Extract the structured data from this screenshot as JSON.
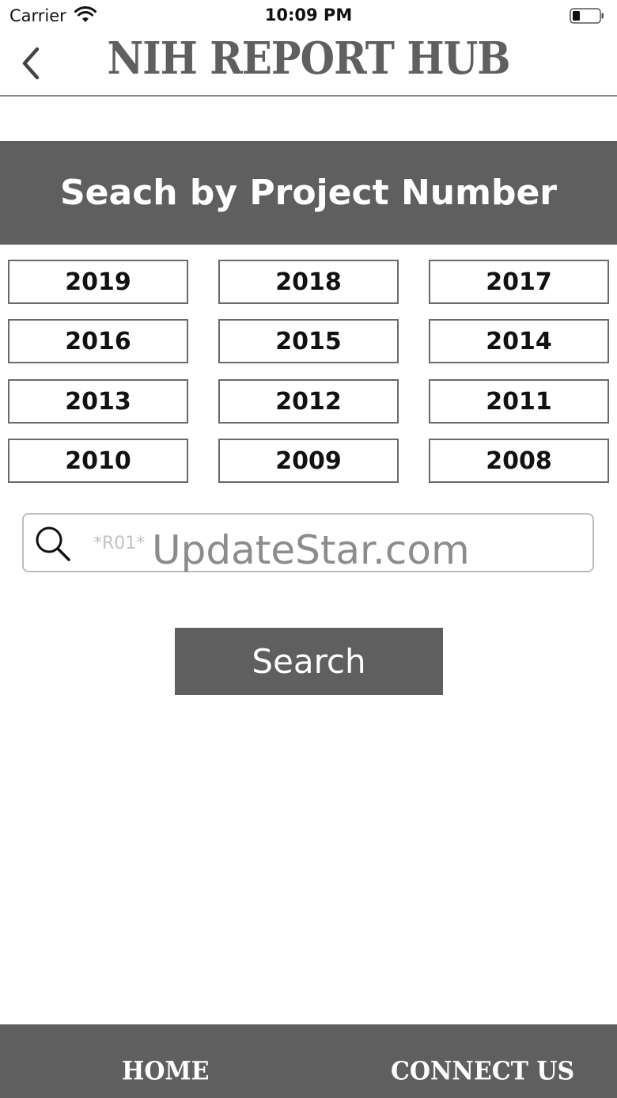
{
  "status_bar": {
    "carrier": "Carrier",
    "time": "10:09 PM",
    "icons": [
      "wifi-icon",
      "battery-icon"
    ]
  },
  "nav": {
    "title": "NIH REPORT HUB",
    "back_icon": "chevron-left-icon"
  },
  "section": {
    "title": "Seach by Project Number"
  },
  "years": [
    "2019",
    "2018",
    "2017",
    "2016",
    "2015",
    "2014",
    "2013",
    "2012",
    "2011",
    "2010",
    "2009",
    "2008"
  ],
  "search": {
    "placeholder": "*R01*",
    "value": "",
    "icon": "search-icon",
    "button_label": "Search"
  },
  "watermark": "UpdateStar.com",
  "tab_bar": {
    "items": [
      {
        "label": "HOME"
      },
      {
        "label": "CONNECT US"
      }
    ]
  },
  "colors": {
    "primary": "#5f5f5f",
    "border": "#6a6a6a",
    "background": "#ffffff"
  }
}
